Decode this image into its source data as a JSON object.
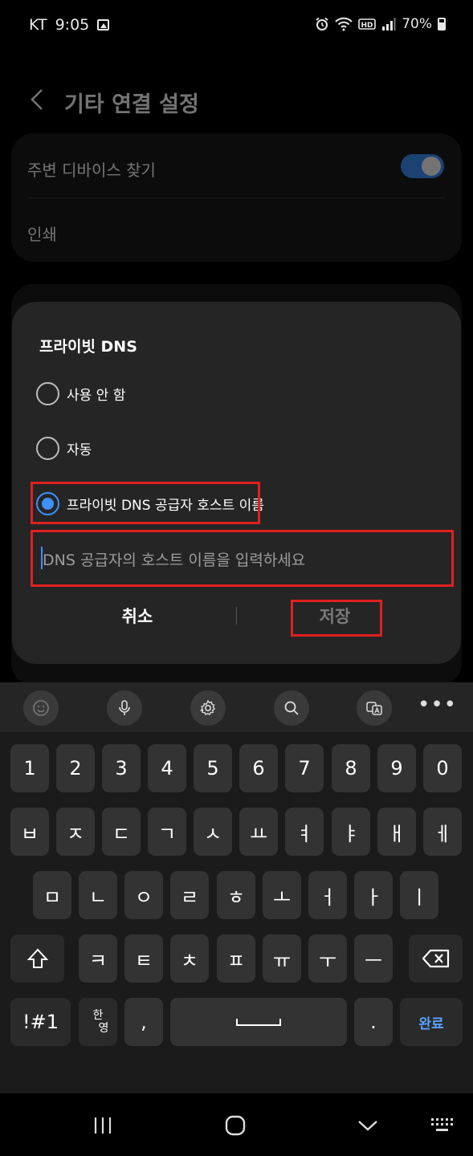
{
  "status_bar": {
    "carrier": "KT",
    "time": "9:05",
    "battery_level": "70%",
    "icons": [
      "image-icon",
      "alarm-icon",
      "wifi-icon",
      "hd-icon",
      "signal-icon",
      "battery-icon"
    ]
  },
  "background_screen": {
    "title": "기타 연결 설정",
    "items": [
      "주변 디바이스 찾기",
      "인쇄"
    ],
    "nearby_toggle_on": true
  },
  "dialog": {
    "title": "프라이빗 DNS",
    "options": [
      {
        "label": "사용 안 함",
        "selected": false
      },
      {
        "label": "자동",
        "selected": false
      },
      {
        "label": "프라이빗 DNS 공급자 호스트 이름",
        "selected": true
      }
    ],
    "hostname_input": {
      "value": "",
      "placeholder": "DNS 공급자의 호스트 이름을 입력하세요"
    },
    "cancel_label": "취소",
    "save_label": "저장"
  },
  "keyboard": {
    "toolbar": [
      "emoji-icon",
      "microphone-icon",
      "settings-icon",
      "search-icon",
      "translate-icon",
      "more-icon"
    ],
    "rows": [
      [
        "1",
        "2",
        "3",
        "4",
        "5",
        "6",
        "7",
        "8",
        "9",
        "0"
      ],
      [
        "ㅂ",
        "ㅈ",
        "ㄷ",
        "ㄱ",
        "ㅅ",
        "ㅛ",
        "ㅕ",
        "ㅑ",
        "ㅐ",
        "ㅔ"
      ],
      [
        "ㅁ",
        "ㄴ",
        "ㅇ",
        "ㄹ",
        "ㅎ",
        "ㅗ",
        "ㅓ",
        "ㅏ",
        "ㅣ"
      ],
      [
        "ㅋ",
        "ㅌ",
        "ㅊ",
        "ㅍ",
        "ㅠ",
        "ㅜ",
        "ㅡ"
      ]
    ],
    "symbols_label": "!#1",
    "lang_top": "한",
    "lang_bottom": "영",
    "comma": ",",
    "period": ".",
    "done_label": "완료"
  },
  "colors": {
    "accent": "#3e91ff",
    "highlight": "#e02020",
    "dialog_bg": "#252525",
    "key_bg": "#333333"
  }
}
